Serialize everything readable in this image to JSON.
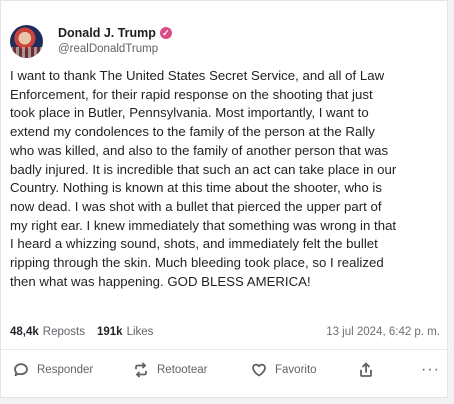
{
  "author": {
    "display_name": "Donald J. Trump",
    "handle": "@realDonaldTrump",
    "verified_icon": "checkmark-badge-icon",
    "verified_color": "#d94c88"
  },
  "post": {
    "lines": [
      "I want to thank The United States Secret Service, and all of Law",
      "Enforcement, for their rapid response on the shooting that just",
      "took place in Butler, Pennsylvania. Most importantly, I want to",
      "extend my condolences to the family of the person at the Rally",
      "who was killed, and also to the family of another person that was",
      "badly injured. It is incredible that such an act can take place in our",
      "Country. Nothing is known at this time about the shooter, who is",
      "now dead. I was shot with a bullet that pierced the upper part of",
      "my right ear. I knew immediately that something was wrong in that",
      "I heard a whizzing sound, shots, and immediately felt the bullet",
      "ripping through the skin. Much bleeding took place, so I realized",
      "then what was happening. GOD BLESS AMERICA!"
    ]
  },
  "stats": {
    "reposts_count": "48,4k",
    "reposts_label": "Reposts",
    "likes_count": "191k",
    "likes_label": "Likes",
    "timestamp": "13 jul 2024, 6:42 p. m."
  },
  "actions": {
    "reply_label": "Responder",
    "repost_label": "Retootear",
    "favorite_label": "Favorito",
    "reply_icon": "chat-bubble-icon",
    "repost_icon": "repost-arrows-icon",
    "favorite_icon": "heart-icon",
    "share_icon": "share-upload-icon",
    "more_icon": "more-dots-icon"
  }
}
